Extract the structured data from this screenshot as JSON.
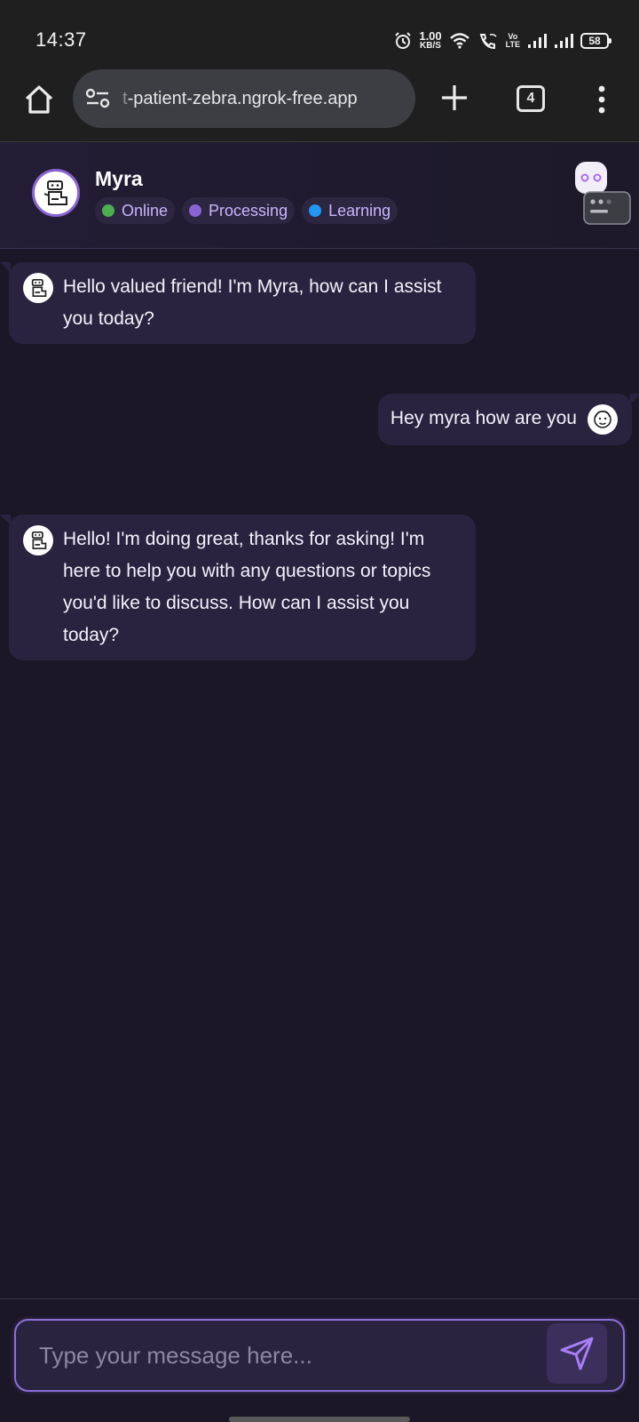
{
  "status_bar": {
    "time": "14:37",
    "net_speed_value": "1.00",
    "net_speed_unit": "KB/S",
    "volte_line1": "Vo",
    "volte_line2": "LTE",
    "battery": "58",
    "icons": [
      "alarm-icon",
      "wifi-icon",
      "wifi-calling-icon",
      "volte-icon",
      "signal-icon",
      "signal-icon",
      "battery-icon"
    ]
  },
  "browser": {
    "url_faded": "t",
    "url": "-patient-zebra.ngrok-free.app",
    "tab_count": "4",
    "icons": [
      "home-icon",
      "site-settings-icon",
      "plus-icon",
      "tabs-icon",
      "more-vert-icon"
    ]
  },
  "chat_header": {
    "name": "Myra",
    "statuses": [
      {
        "label": "Online",
        "color": "#4caf50"
      },
      {
        "label": "Processing",
        "color": "#8a63d2"
      },
      {
        "label": "Learning",
        "color": "#2196f3"
      }
    ]
  },
  "messages": [
    {
      "sender": "bot",
      "text": "Hello valued friend! I'm Myra, how can I assist you today?"
    },
    {
      "sender": "user",
      "text": "Hey myra how are you"
    },
    {
      "sender": "bot",
      "text": "Hello! I'm doing great, thanks for asking! I'm here to help you with any questions or topics you'd like to discuss. How can I assist you today?"
    }
  ],
  "composer": {
    "placeholder": "Type your message here...",
    "value": ""
  },
  "colors": {
    "background": "#1b1726",
    "bubble": "#2a2340",
    "accent": "#8b6fd6"
  }
}
